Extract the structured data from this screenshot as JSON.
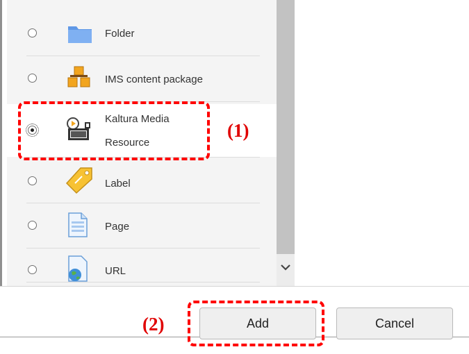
{
  "activity_list": {
    "items": [
      {
        "label": "Folder",
        "icon": "folder-icon",
        "selected": false
      },
      {
        "label": "IMS content package",
        "icon": "ims-package-icon",
        "selected": false
      },
      {
        "label_line1": "Kaltura Media",
        "label_line2": "Resource",
        "icon": "kaltura-media-icon",
        "selected": true
      },
      {
        "label": "Label",
        "icon": "label-tag-icon",
        "selected": false
      },
      {
        "label": "Page",
        "icon": "page-icon",
        "selected": false
      },
      {
        "label": "URL",
        "icon": "url-globe-icon",
        "selected": false
      }
    ]
  },
  "annotations": {
    "step1": "(1)",
    "step2": "(2)",
    "color": "#ff0000"
  },
  "footer": {
    "add_label": "Add",
    "cancel_label": "Cancel"
  }
}
